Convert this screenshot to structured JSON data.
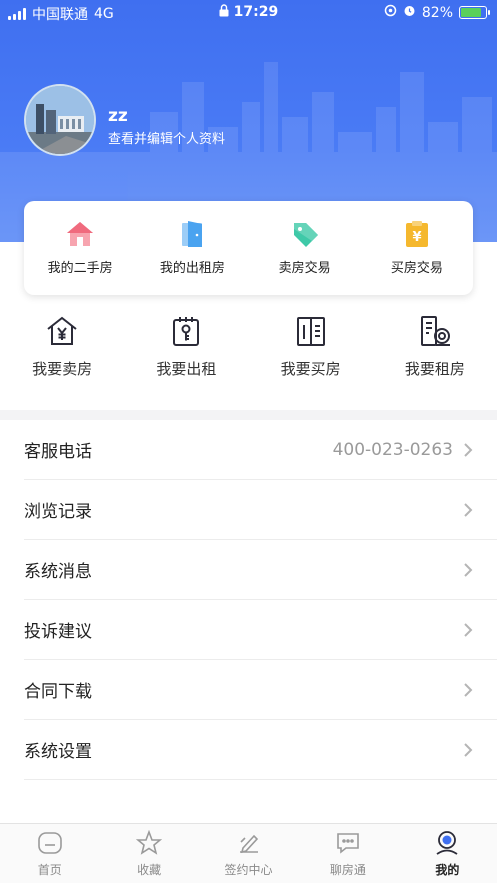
{
  "status_bar": {
    "carrier": "中国联通",
    "network": "4G",
    "time": "17:29",
    "battery": "82%",
    "battery_level": 0.82
  },
  "profile": {
    "username": "zz",
    "edit_link": "查看并编辑个人资料"
  },
  "quick_card": [
    {
      "label": "我的二手房",
      "icon": "house-icon",
      "color": "#f06b7e"
    },
    {
      "label": "我的出租房",
      "icon": "door-icon",
      "color": "#4aa3f0"
    },
    {
      "label": "卖房交易",
      "icon": "tag-icon",
      "color": "#3fc9a8"
    },
    {
      "label": "买房交易",
      "icon": "yuan-clipboard-icon",
      "color": "#f5b82e"
    }
  ],
  "actions": [
    {
      "label": "我要卖房",
      "icon": "house-yuan-icon"
    },
    {
      "label": "我要出租",
      "icon": "key-icon"
    },
    {
      "label": "我要买房",
      "icon": "building-icon"
    },
    {
      "label": "我要租房",
      "icon": "building-search-icon"
    }
  ],
  "menu": [
    {
      "title": "客服电话",
      "value": "400-023-0263"
    },
    {
      "title": "浏览记录",
      "value": ""
    },
    {
      "title": "系统消息",
      "value": ""
    },
    {
      "title": "投诉建议",
      "value": ""
    },
    {
      "title": "合同下载",
      "value": ""
    },
    {
      "title": "系统设置",
      "value": ""
    }
  ],
  "tabbar": [
    {
      "label": "首页",
      "icon": "home-icon"
    },
    {
      "label": "收藏",
      "icon": "star-icon"
    },
    {
      "label": "签约中心",
      "icon": "sign-icon"
    },
    {
      "label": "聊房通",
      "icon": "chat-icon"
    },
    {
      "label": "我的",
      "icon": "profile-icon",
      "active": true
    }
  ],
  "colors": {
    "header_blue": "#4a7bf5",
    "text_dark": "#222222",
    "text_gray": "#9a9a9a"
  }
}
